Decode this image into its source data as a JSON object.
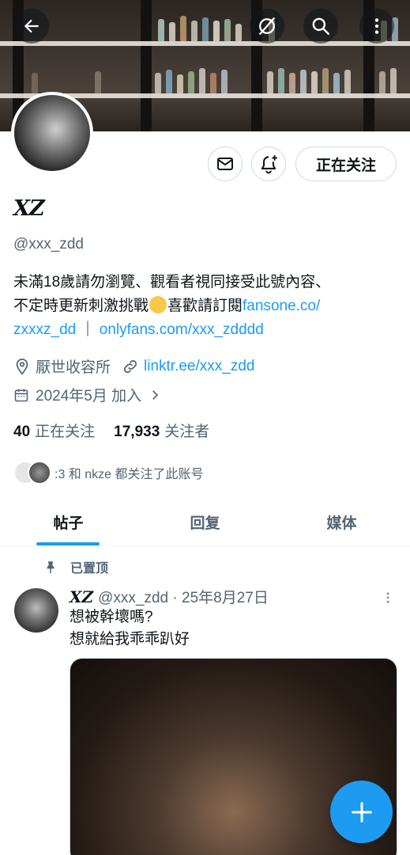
{
  "banner": {
    "icons": [
      "back-arrow-icon",
      "grok-icon",
      "search-icon",
      "more-vertical-icon"
    ]
  },
  "profile": {
    "name": "XZ",
    "handle": "@xxx_zdd",
    "follow_label": "正在关注",
    "bio_line1": "未滿18歲請勿瀏覽、觀看者視同接受此號內容、",
    "bio_line2_prefix": "不定時更新刺激挑戰",
    "bio_line2_mid": "喜歡請訂閱",
    "bio_link1_part1": "fansone.co/",
    "bio_link1_part2": "zxxxz_dd",
    "bio_separator": " ｜",
    "bio_link2": "onlyfans.com/xxx_zdddd",
    "location": "厭世收容所",
    "website": "linktr.ee/xxx_zdd",
    "joined": "2024年5月 加入"
  },
  "stats": {
    "following_count": "40",
    "following_label": "正在关注",
    "followers_count": "17,933",
    "followers_label": "关注者"
  },
  "mutual": {
    "text": ":3 和 nkze 都关注了此账号"
  },
  "tabs": [
    {
      "label": "帖子",
      "active": true
    },
    {
      "label": "回复",
      "active": false
    },
    {
      "label": "媒体",
      "active": false
    }
  ],
  "post": {
    "pinned_label": "已置顶",
    "author": "XZ",
    "handle_date": "@xxx_zdd · 25年8月27日",
    "line1": "想被幹壞嗎?",
    "line2": "想就給我乖乖趴好"
  },
  "colors": {
    "accent": "#1d9bf0",
    "text": "#0f1419",
    "muted": "#536471",
    "border": "#cfd9de"
  }
}
